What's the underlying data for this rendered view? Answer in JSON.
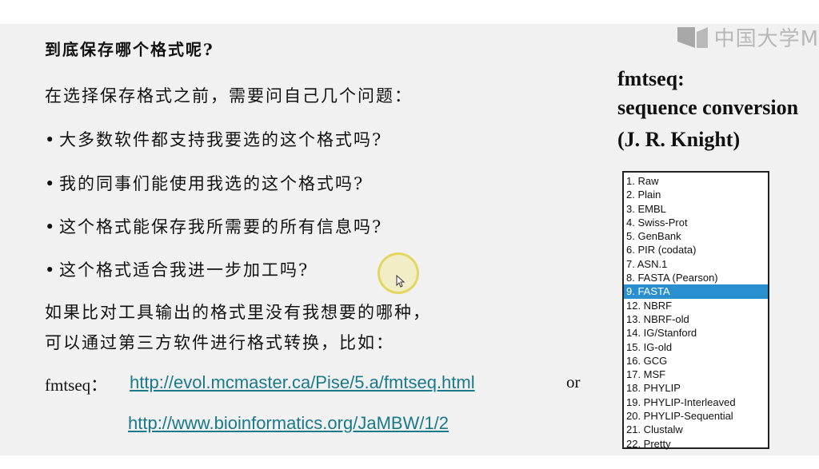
{
  "slide": {
    "question_title": "到底保存哪个格式呢?",
    "intro": "在选择保存格式之前，需要问自己几个问题：",
    "bullet_symbol": "•",
    "bullets": [
      "大多数软件都支持我要选的这个格式吗?",
      "我的同事们能使用我选的这个格式吗?",
      "这个格式能保存我所需要的所有信息吗?",
      "这个格式适合我进一步加工吗?"
    ],
    "paragraph_line1": "如果比对工具输出的格式里没有我想要的哪种，",
    "paragraph_line2": "可以通过第三方软件进行格式转换，比如：",
    "fmtseq_label": "fmtseq：",
    "link1": "http://evol.mcmaster.ca/Pise/5.a/fmtseq.html",
    "or_text": "or",
    "link2": "http://www.bioinformatics.org/JaMBW/1/2"
  },
  "fmtseq_panel": {
    "title_line1": "fmtseq:",
    "title_line2": "sequence conversion",
    "title_line3": "(J. R. Knight)",
    "formats": [
      "1. Raw",
      "2. Plain",
      "3. EMBL",
      "4. Swiss-Prot",
      "5. GenBank",
      "6. PIR (codata)",
      "7. ASN.1",
      "8. FASTA (Pearson)",
      "9. FASTA",
      "12. NBRF",
      "13. NBRF-old",
      "14. IG/Stanford",
      "15. IG-old",
      "16. GCG",
      "17. MSF",
      "18. PHYLIP",
      "19. PHYLIP-Interleaved",
      "20. PHYLIP-Sequential",
      "21. Clustalw",
      "22. Pretty"
    ],
    "selected_index": 8,
    "selected_color": "#2a8fcf"
  },
  "watermark": {
    "text": "中国大学M",
    "icon": "mooc-logo-icon"
  },
  "colors": {
    "slide_background": "#f1f1f1",
    "link": "#1a7a8a"
  }
}
